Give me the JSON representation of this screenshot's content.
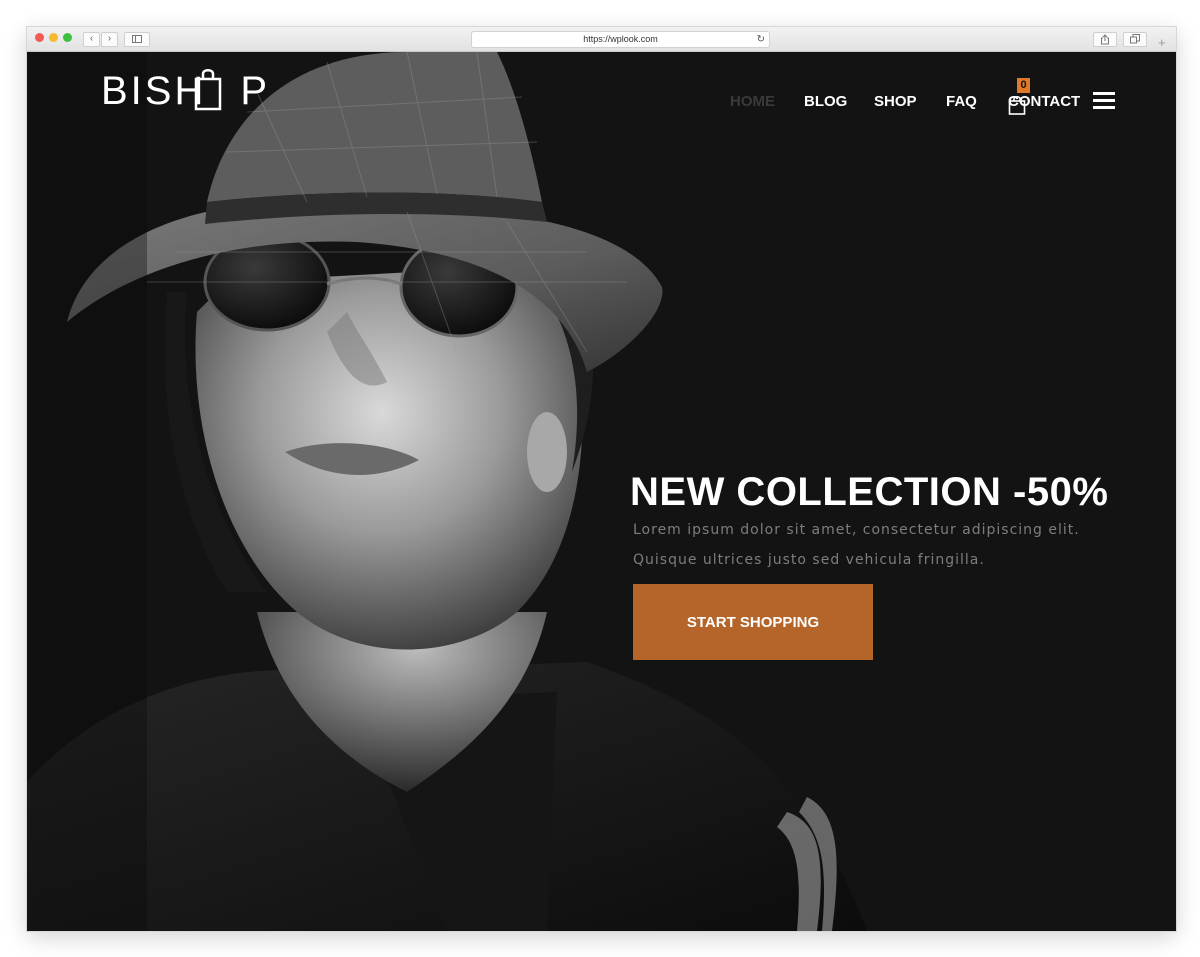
{
  "browser": {
    "url": "https://wplook.com",
    "back_glyph": "‹",
    "forward_glyph": "›",
    "reload_glyph": "↻",
    "new_tab_glyph": "+"
  },
  "site": {
    "logo_part1": "BISH",
    "logo_part2": "P",
    "nav": [
      {
        "label": "HOME",
        "active": true
      },
      {
        "label": "BLOG",
        "active": false
      },
      {
        "label": "SHOP",
        "active": false
      },
      {
        "label": "FAQ",
        "active": false
      },
      {
        "label": "CONTACT",
        "active": false
      }
    ],
    "cart_count": "0",
    "accent": "#b5652a",
    "badge_color": "#e07a2a"
  },
  "hero": {
    "headline": "NEW COLLECTION -50%",
    "sub1": "Lorem ipsum dolor sit amet, consectetur adipiscing elit.",
    "sub2": "Quisque ultrices justo sed vehicula fringilla.",
    "cta": "START SHOPPING"
  },
  "icons": [
    "close-window-icon",
    "minimize-window-icon",
    "zoom-window-icon",
    "back-arrow-icon",
    "forward-arrow-icon",
    "sidebar-icon",
    "reload-icon",
    "share-icon",
    "tabs-icon",
    "new-tab-icon",
    "shopping-bag-icon",
    "cart-icon",
    "hamburger-menu-icon"
  ]
}
